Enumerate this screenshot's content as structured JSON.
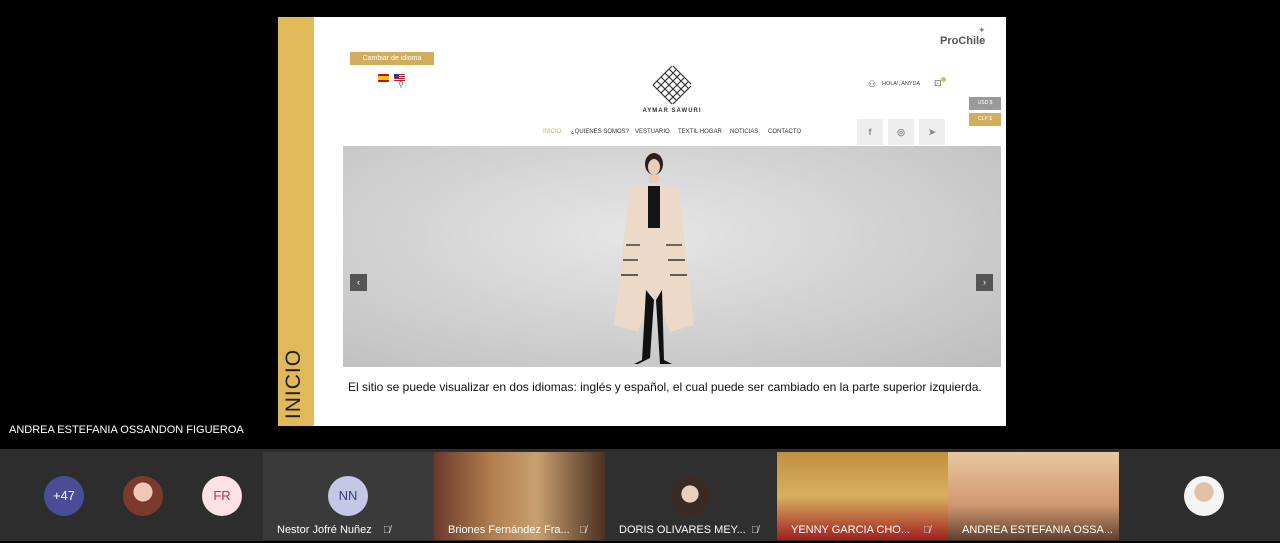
{
  "slide": {
    "side_title": "INICIO",
    "caption": "El sitio se puede visualizar en dos idiomas: inglés y español, el cual puede ser cambiado en la parte superior izquierda."
  },
  "website": {
    "lang_button": "Cambiar de idioma",
    "prochile": "ProChile",
    "brand": "AYMAR SAWURI",
    "user_greeting": "HOLA!, ANYDA",
    "currency_usd": "USD $",
    "currency_clp": "CLP $",
    "nav": [
      "INICIO",
      "¿QUIENES SOMOS?",
      "VESTUARIO",
      "TEXTIL HOGAR",
      "NOTICIAS",
      "CONTACTO"
    ],
    "social": [
      "f",
      "◎",
      "➤"
    ]
  },
  "meeting": {
    "presenter_name": "ANDREA ESTEFANIA OSSANDON FIGUEROA",
    "overflow_count": "+47",
    "initials_fr": "FR",
    "initials_nn": "NN",
    "participants": [
      "Nestor Jofré Nuñez",
      "Briones Fernández Fra...",
      "DORIS OLIVARES MEY...",
      "YENNY GARCIA CHO...",
      "ANDREA ESTEFANIA OSSA..."
    ],
    "muted_icon": "muted-mic-icon"
  }
}
